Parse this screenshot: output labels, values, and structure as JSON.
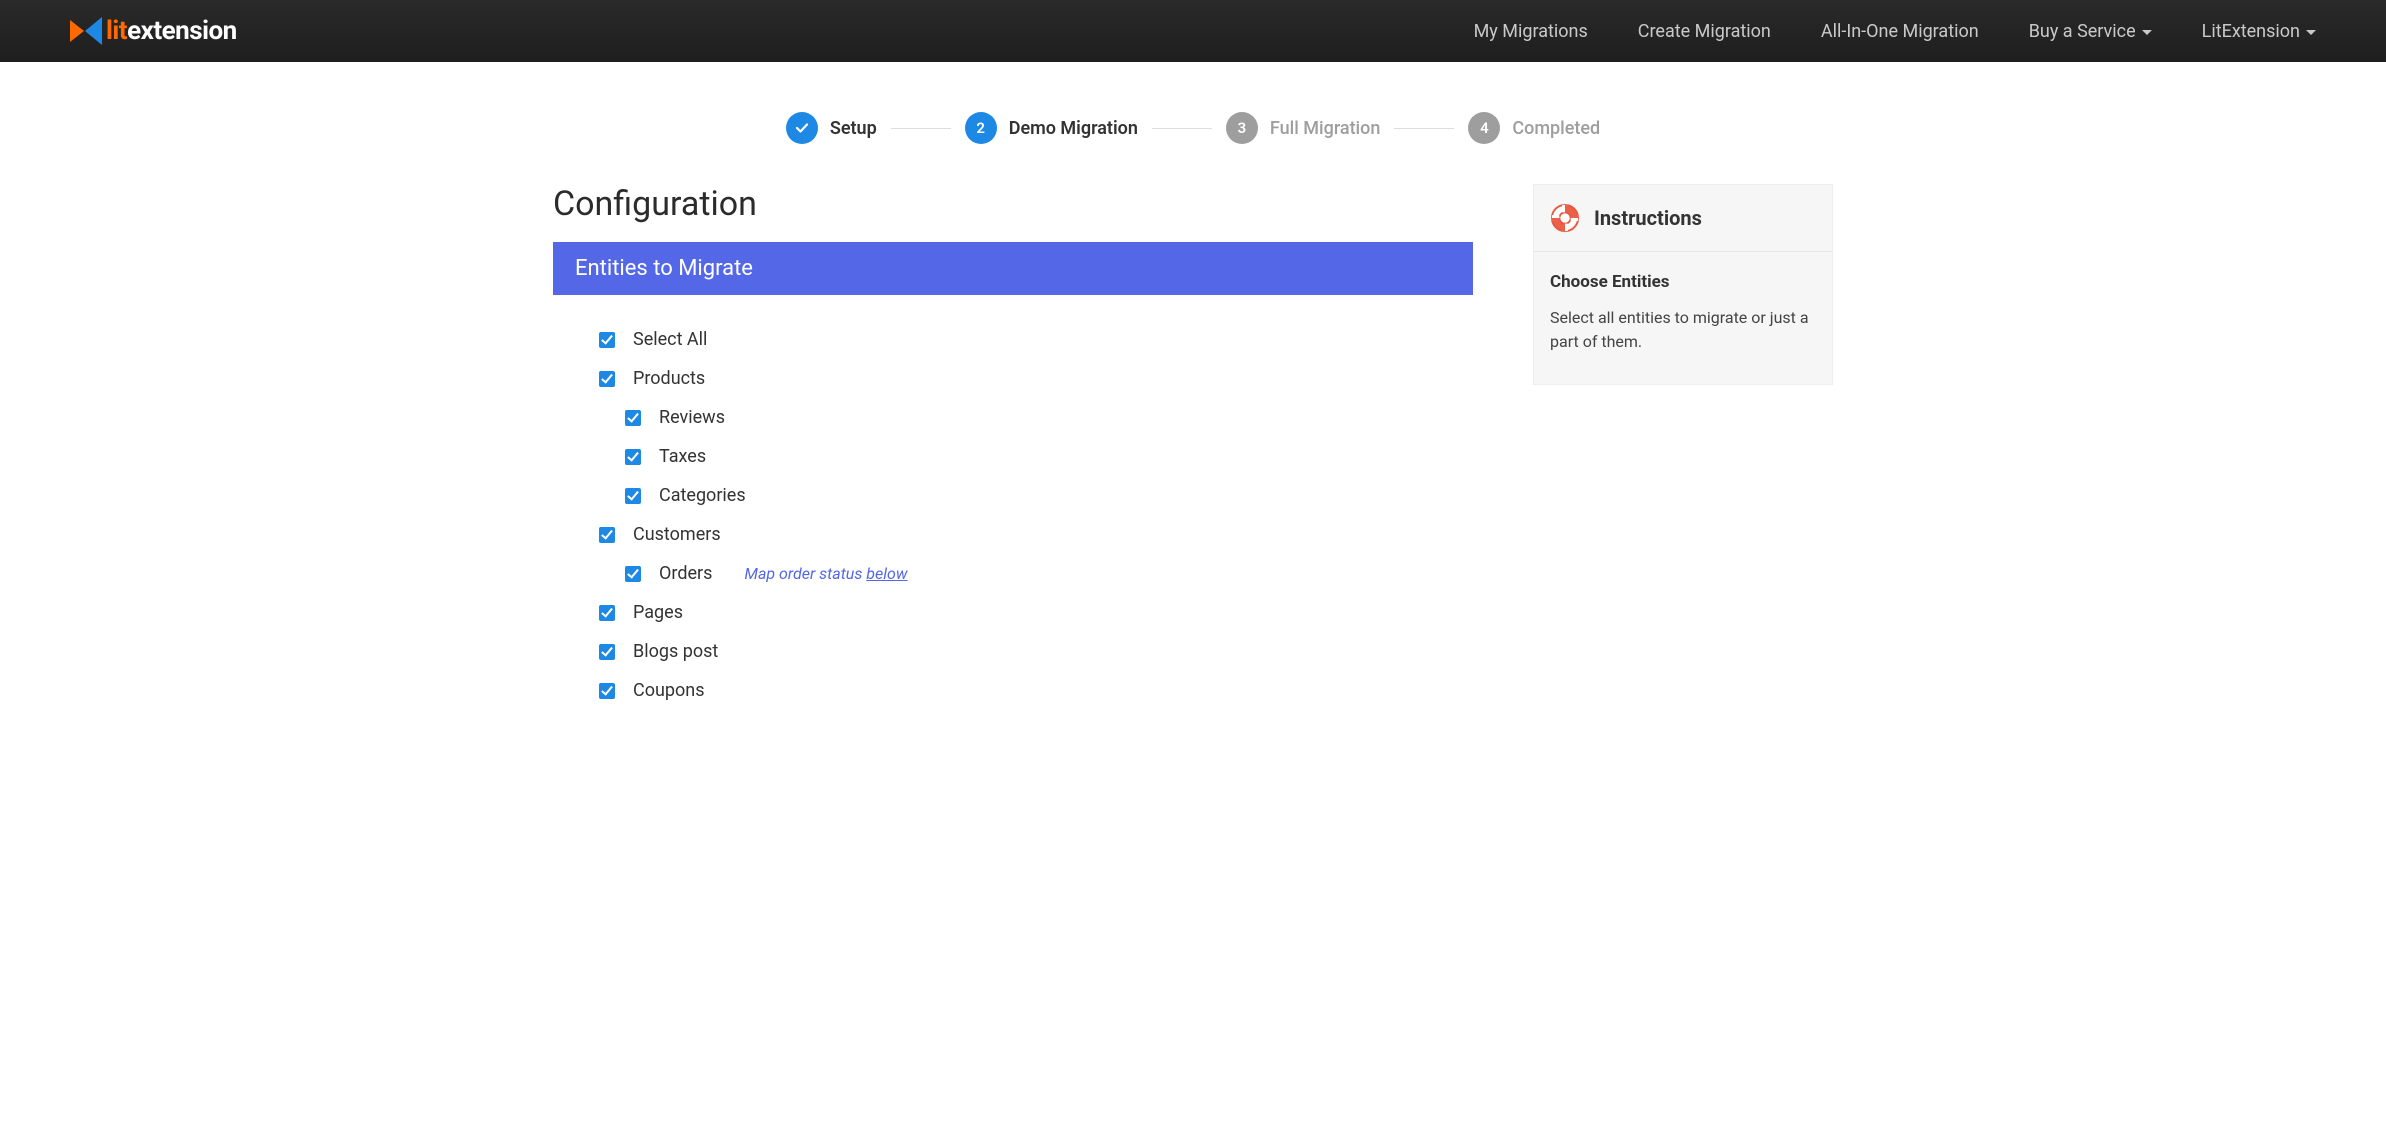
{
  "brand": {
    "lit": "lit",
    "extension": "extension"
  },
  "nav": {
    "items": [
      {
        "label": "My Migrations",
        "dropdown": false
      },
      {
        "label": "Create Migration",
        "dropdown": false
      },
      {
        "label": "All-In-One Migration",
        "dropdown": false
      },
      {
        "label": "Buy a Service",
        "dropdown": true
      },
      {
        "label": "LitExtension",
        "dropdown": true
      }
    ]
  },
  "stepper": {
    "steps": [
      {
        "num": "1",
        "label": "Setup",
        "state": "done"
      },
      {
        "num": "2",
        "label": "Demo Migration",
        "state": "active"
      },
      {
        "num": "3",
        "label": "Full Migration",
        "state": "future"
      },
      {
        "num": "4",
        "label": "Completed",
        "state": "future"
      }
    ]
  },
  "page": {
    "title": "Configuration",
    "panel": "Entities to Migrate"
  },
  "entities": {
    "selectAll": "Select All",
    "products": "Products",
    "reviews": "Reviews",
    "taxes": "Taxes",
    "categories": "Categories",
    "customers": "Customers",
    "orders": "Orders",
    "ordersNotePrefix": "Map order status ",
    "ordersNoteLink": "below",
    "pages": "Pages",
    "blogs": "Blogs post",
    "coupons": "Coupons"
  },
  "instructions": {
    "title": "Instructions",
    "subtitle": "Choose Entities",
    "body": "Select all entities to migrate or just a part of them."
  }
}
